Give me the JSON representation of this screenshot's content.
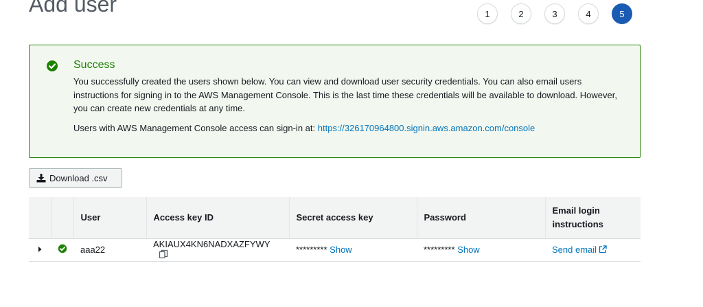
{
  "page": {
    "title": "Add user"
  },
  "steps": [
    "1",
    "2",
    "3",
    "4",
    "5"
  ],
  "alert": {
    "title": "Success",
    "message": "You successfully created the users shown below. You can view and download user security credentials. You can also email users instructions for signing in to the AWS Management Console. This is the last time these credentials will be available to download. However, you can create new credentials at any time.",
    "signin_prefix": "Users with AWS Management Console access can sign-in at: ",
    "signin_url": "https://326170964800.signin.aws.amazon.com/console",
    "success_color": "#1d8102"
  },
  "download_button": {
    "label": "Download .csv"
  },
  "table": {
    "headers": {
      "user": "User",
      "access_key": "Access key ID",
      "secret": "Secret access key",
      "password": "Password",
      "email": "Email login instructions"
    },
    "rows": [
      {
        "user": "aaa22",
        "access_key": "AKIAUX4KN6NADXAZFYWY",
        "secret_masked": "*********",
        "secret_show": "Show",
        "password_masked": "*********",
        "password_show": "Show",
        "email_link": "Send email"
      }
    ]
  },
  "colors": {
    "link": "#0073bb",
    "active_step": "#1a5cb3"
  }
}
